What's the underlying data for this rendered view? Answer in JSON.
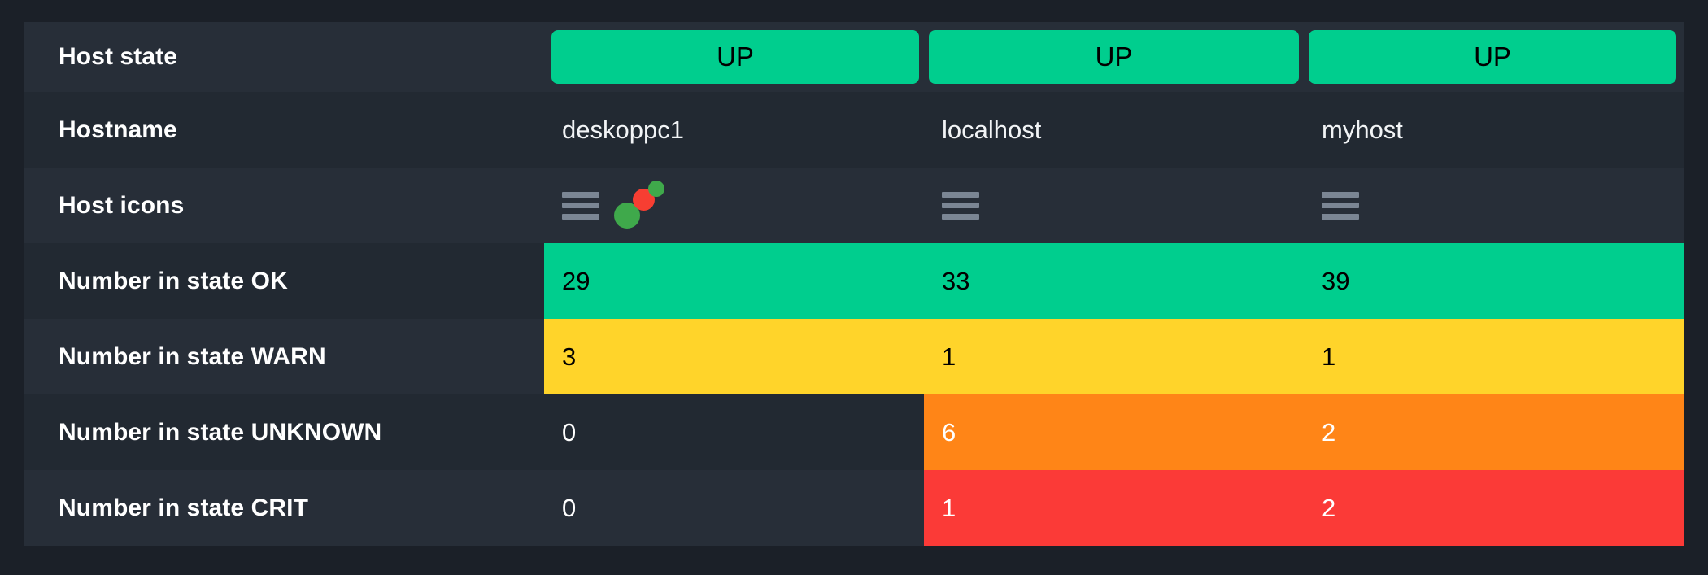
{
  "theme": {
    "page_background": "#1b2028",
    "row_background": "#222932",
    "row_background_alt": "#272e38",
    "text_primary": "#ffffff",
    "color_ok": "#00ce8e",
    "color_warn": "#ffd42a",
    "color_unknown": "#ff8517",
    "color_crit": "#fb3a37",
    "icon_gray": "#7b8694",
    "dot_green": "#3fa94b",
    "dot_red": "#f73e32"
  },
  "table": {
    "rows": [
      {
        "label": "Host state",
        "type": "state_button",
        "values": [
          "UP",
          "UP",
          "UP"
        ]
      },
      {
        "label": "Hostname",
        "type": "text",
        "values": [
          "deskoppc1",
          "localhost",
          "myhost"
        ]
      },
      {
        "label": "Host icons",
        "type": "icons",
        "values": [
          {
            "icons": [
              "menu-icon",
              "topology-icon"
            ]
          },
          {
            "icons": [
              "menu-icon"
            ]
          },
          {
            "icons": [
              "menu-icon"
            ]
          }
        ]
      },
      {
        "label": "Number in state OK",
        "type": "number",
        "state": "ok",
        "values": [
          "29",
          "33",
          "39"
        ],
        "filled": [
          true,
          true,
          true
        ]
      },
      {
        "label": "Number in state WARN",
        "type": "number",
        "state": "warn",
        "values": [
          "3",
          "1",
          "1"
        ],
        "filled": [
          true,
          true,
          true
        ]
      },
      {
        "label": "Number in state UNKNOWN",
        "type": "number",
        "state": "unknown",
        "values": [
          "0",
          "6",
          "2"
        ],
        "filled": [
          false,
          true,
          true
        ]
      },
      {
        "label": "Number in state CRIT",
        "type": "number",
        "state": "crit",
        "values": [
          "0",
          "1",
          "2"
        ],
        "filled": [
          false,
          true,
          true
        ]
      }
    ]
  }
}
